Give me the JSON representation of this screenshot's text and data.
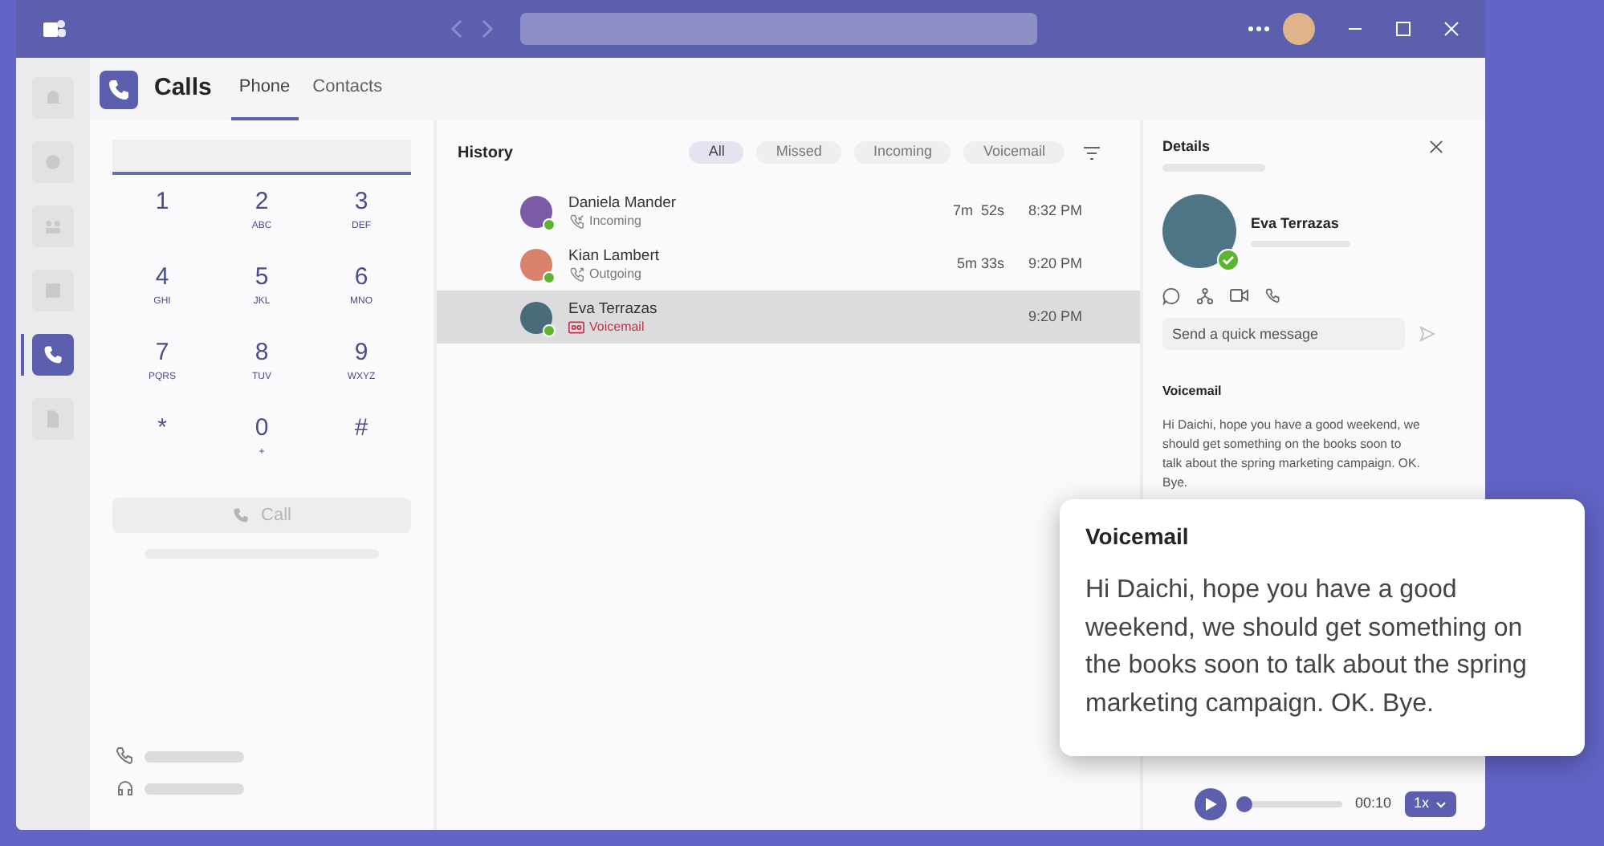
{
  "app": {
    "title": "Calls",
    "tabs": [
      {
        "label": "Phone",
        "selected": true
      },
      {
        "label": "Contacts",
        "selected": false
      }
    ]
  },
  "rail": [
    {
      "selected": false
    },
    {
      "selected": false
    },
    {
      "selected": false
    },
    {
      "selected": false
    },
    {
      "selected": true
    },
    {
      "selected": false
    }
  ],
  "dialpad": {
    "keys": [
      {
        "digit": "1"
      },
      {
        "digit": "2",
        "letters": "ABC"
      },
      {
        "digit": "3",
        "letters": "DEF"
      },
      {
        "digit": "4",
        "letters": "GHI"
      },
      {
        "digit": "5",
        "letters": "JKL"
      },
      {
        "digit": "6",
        "letters": "MNO"
      },
      {
        "digit": "7",
        "letters": "PQRS"
      },
      {
        "digit": "8",
        "letters": "TUV"
      },
      {
        "digit": "9",
        "letters": "WXYZ"
      },
      {
        "digit": "*"
      },
      {
        "digit": "0",
        "letters": "+"
      },
      {
        "digit": "#"
      }
    ],
    "call_button": {
      "label": "Call",
      "disabled": true
    }
  },
  "history": {
    "title": "History",
    "filters": [
      {
        "label": "All",
        "selected": true
      },
      {
        "label": "Missed",
        "selected": false
      },
      {
        "label": "Incoming",
        "selected": false
      },
      {
        "label": "Voicemail",
        "selected": false
      }
    ],
    "rows": [
      {
        "name": "Daniela Mander",
        "kind": "incoming",
        "type_label": "Incoming",
        "duration": "7m  52s",
        "time": "8:32 PM",
        "selected": false
      },
      {
        "name": "Kian Lambert",
        "kind": "outgoing",
        "type_label": "Outgoing",
        "duration": "5m 33s",
        "time": "9:20 PM",
        "selected": false
      },
      {
        "name": "Eva Terrazas",
        "kind": "voicemail",
        "type_label": "Voicemail",
        "time": "9:20 PM",
        "selected": true
      }
    ]
  },
  "details": {
    "title": "Details",
    "contact_name": "Eva Terrazas",
    "message_placeholder": "Send a quick message",
    "voicemail_heading": "Voicemail",
    "voicemail_text": "Hi Daichi, hope you have a good weekend, we should get something on the books soon to talk about the spring marketing campaign. OK. Bye.",
    "player": {
      "time": "00:10",
      "speed": "1x",
      "level": 0.0
    }
  },
  "popup": {
    "title": "Voicemail",
    "text": "Hi Daichi, hope you have a good weekend, we should get something on the books soon to talk about the spring marketing campaign. OK. Bye."
  }
}
